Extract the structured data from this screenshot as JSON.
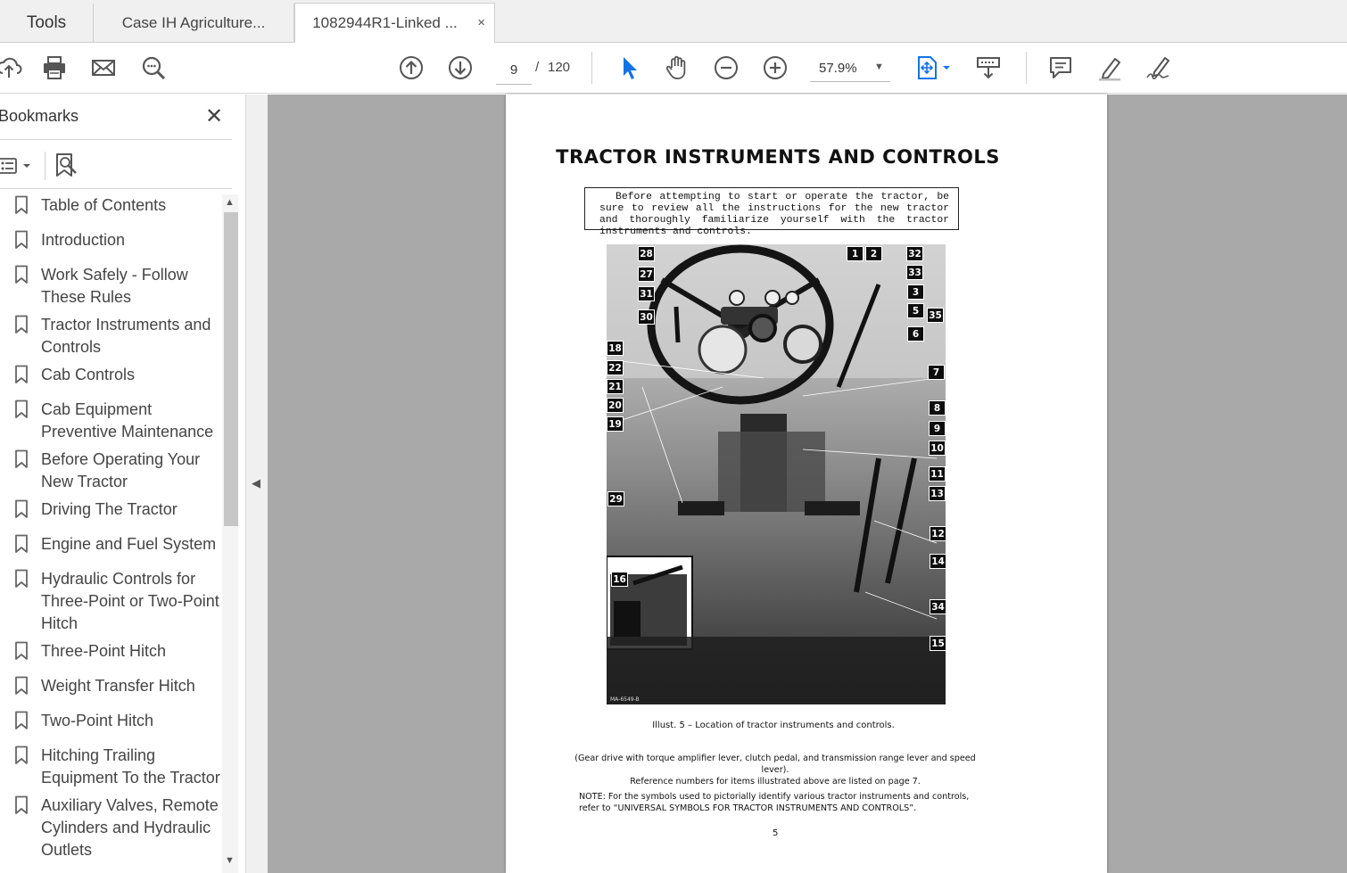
{
  "tabs": {
    "tools": "Tools",
    "tab1": "Case IH Agriculture...",
    "tab2": "1082944R1-Linked ...",
    "close": "×"
  },
  "toolbar": {
    "current_page": "9",
    "page_separator": "/",
    "total_pages": "120",
    "zoom": "57.9%",
    "icons": [
      "upload-icon",
      "print-icon",
      "mail-icon",
      "search-zoom-icon",
      "page-up-icon",
      "page-down-icon",
      "select-cursor-icon",
      "hand-icon",
      "zoom-out-icon",
      "zoom-in-icon",
      "fit-page-icon",
      "scroll-mode-icon",
      "comment-icon",
      "highlight-pen-icon",
      "sign-icon"
    ],
    "accent": "#1473e6"
  },
  "bookmarks": {
    "title": "Bookmarks",
    "close": "✕",
    "items": [
      "Table of Contents",
      "Introduction",
      "Work Safely - Follow These Rules",
      "Tractor Instruments and Controls",
      "Cab Controls",
      "Cab Equipment Preventive Maintenance",
      "Before Operating Your New Tractor",
      "Driving The Tractor",
      "Engine and Fuel System",
      "Hydraulic Controls for Three-Point or Two-Point Hitch",
      "Three-Point Hitch",
      "Weight Transfer Hitch",
      "Two-Point Hitch",
      "Hitching Trailing Equipment To the Tractor",
      "Auxiliary Valves, Remote Cylinders and Hydraulic Outlets"
    ]
  },
  "document": {
    "title": "TRACTOR INSTRUMENTS AND CONTROLS",
    "notice": "Before attempting to start or operate the tractor, be sure to review all the instructions for the new tractor and thoroughly familiarize yourself with the tractor instruments and controls.",
    "callouts": [
      "28",
      "1",
      "2",
      "32",
      "27",
      "33",
      "31",
      "3",
      "30",
      "5",
      "35",
      "6",
      "18",
      "7",
      "22",
      "21",
      "20",
      "8",
      "19",
      "9",
      "10",
      "11",
      "13",
      "29",
      "12",
      "14",
      "16",
      "34",
      "15"
    ],
    "photo_code": "MA-6549-B",
    "caption": "Illust. 5 – Location of tractor instruments and controls.",
    "note1_line1": "(Gear drive with torque amplifier lever, clutch pedal, and transmission range lever and speed lever).",
    "note1_line2": "Reference numbers for items illustrated above are listed on page 7.",
    "note2_line1": "NOTE: For the symbols used to pictorially identify various tractor instruments and controls,",
    "note2_line2": "refer to “UNIVERSAL SYMBOLS FOR TRACTOR INSTRUMENTS AND CONTROLS”.",
    "page_number": "5"
  }
}
